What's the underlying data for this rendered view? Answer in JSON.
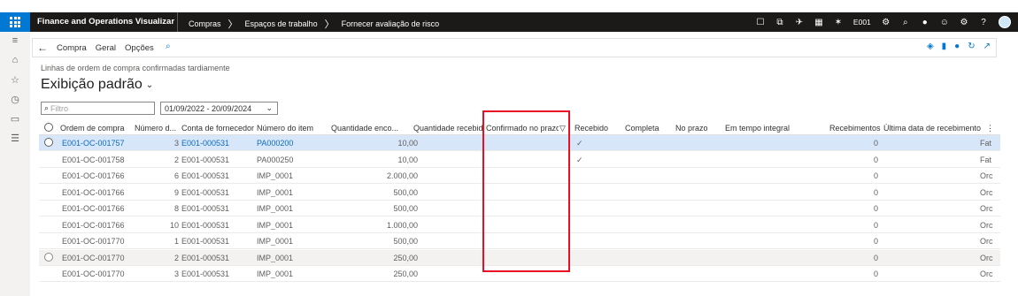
{
  "nav": {
    "app_title": "Finance and Operations Visualizar",
    "breadcrumbs": [
      "Compras",
      "Espaços de trabalho",
      "Fornecer avaliação de risco"
    ],
    "company": "E001"
  },
  "action_pane": {
    "items": [
      "Compra",
      "Geral",
      "Opções"
    ]
  },
  "page": {
    "subtitle": "Linhas de ordem de compra confirmadas tardiamente",
    "view_title": "Exibição padrão",
    "filter_placeholder": "Filtro",
    "date_range": "01/09/2022 - 20/09/2024"
  },
  "grid": {
    "headers": {
      "po": "Ordem de compra",
      "line": "Número d...",
      "vendor": "Conta de fornecedor",
      "item": "Número do item",
      "qty": "Quantidade enco...",
      "recv_qty": "Quantidade recebida",
      "confirmed": "Confirmado no prazo",
      "received": "Recebido",
      "complete": "Completa",
      "ontime": "No prazo",
      "in_full": "Em tempo integral",
      "receipts": "Recebimentos",
      "last_date": "Última data de recebimento"
    },
    "rows": [
      {
        "po": "E001-OC-001757",
        "line": "3",
        "vendor": "E001-000531",
        "item": "PA000200",
        "qty": "10,00",
        "received": "✓",
        "receipts": "0",
        "last": "Fat"
      },
      {
        "po": "E001-OC-001758",
        "line": "2",
        "vendor": "E001-000531",
        "item": "PA000250",
        "qty": "10,00",
        "received": "✓",
        "receipts": "0",
        "last": "Fat"
      },
      {
        "po": "E001-OC-001766",
        "line": "6",
        "vendor": "E001-000531",
        "item": "IMP_0001",
        "qty": "2.000,00",
        "received": "",
        "receipts": "0",
        "last": "Orc"
      },
      {
        "po": "E001-OC-001766",
        "line": "9",
        "vendor": "E001-000531",
        "item": "IMP_0001",
        "qty": "500,00",
        "received": "",
        "receipts": "0",
        "last": "Orc"
      },
      {
        "po": "E001-OC-001766",
        "line": "8",
        "vendor": "E001-000531",
        "item": "IMP_0001",
        "qty": "500,00",
        "received": "",
        "receipts": "0",
        "last": "Orc"
      },
      {
        "po": "E001-OC-001766",
        "line": "10",
        "vendor": "E001-000531",
        "item": "IMP_0001",
        "qty": "1.000,00",
        "received": "",
        "receipts": "0",
        "last": "Orc"
      },
      {
        "po": "E001-OC-001770",
        "line": "1",
        "vendor": "E001-000531",
        "item": "IMP_0001",
        "qty": "500,00",
        "received": "",
        "receipts": "0",
        "last": "Orc"
      },
      {
        "po": "E001-OC-001770",
        "line": "2",
        "vendor": "E001-000531",
        "item": "IMP_0001",
        "qty": "250,00",
        "received": "",
        "receipts": "0",
        "last": "Orc"
      },
      {
        "po": "E001-OC-001770",
        "line": "3",
        "vendor": "E001-000531",
        "item": "IMP_0001",
        "qty": "250,00",
        "received": "",
        "receipts": "0",
        "last": "Orc"
      }
    ]
  },
  "colors": {
    "accent": "#0078d4",
    "nav_bg": "#1b1a19",
    "selected_row": "#d7e7f9",
    "highlight_box": "#e81123"
  }
}
